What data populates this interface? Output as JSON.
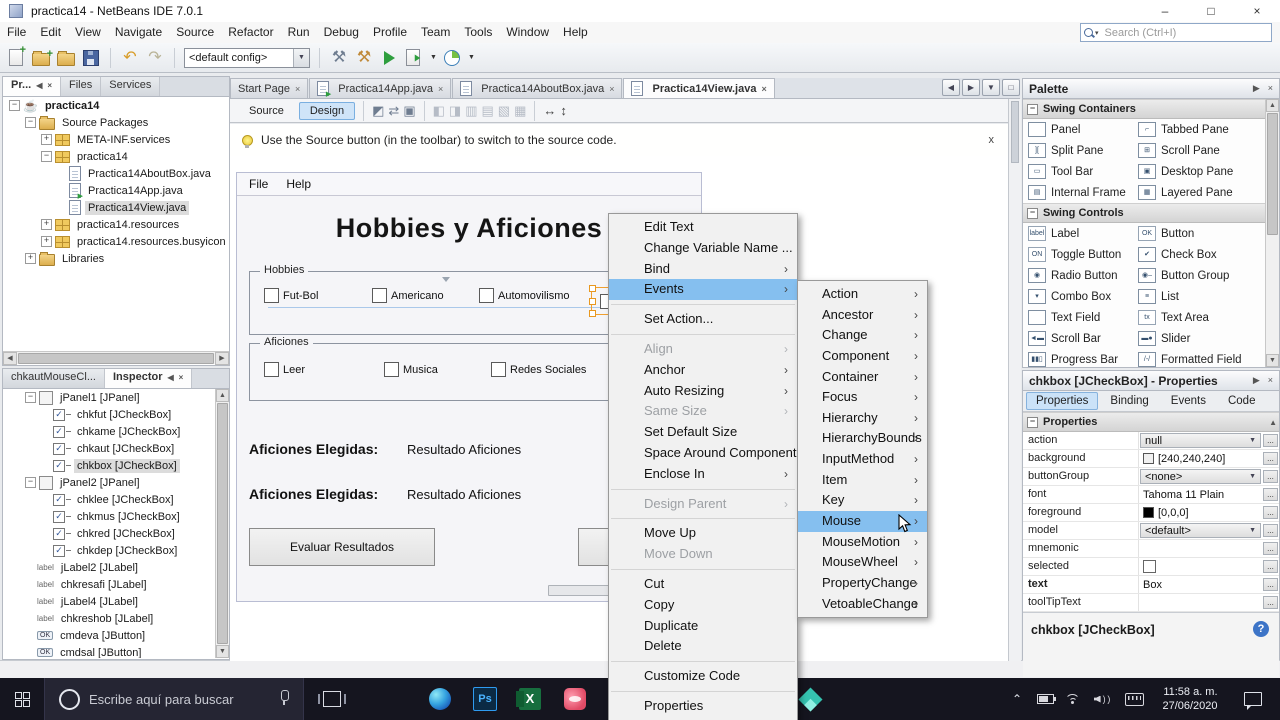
{
  "window": {
    "title": "practica14 - NetBeans IDE 7.0.1",
    "controls": {
      "minimize": "–",
      "maximize": "□",
      "close": "×"
    }
  },
  "menubar": {
    "items": [
      "File",
      "Edit",
      "View",
      "Navigate",
      "Source",
      "Refactor",
      "Run",
      "Debug",
      "Profile",
      "Team",
      "Tools",
      "Window",
      "Help"
    ],
    "search_placeholder": "Search (Ctrl+I)"
  },
  "toolbar": {
    "config_value": "<default config>"
  },
  "projects": {
    "tabs": [
      "Pr...",
      "Files",
      "Services"
    ],
    "tree": [
      {
        "label": "practica14",
        "icon": "project-icon",
        "indent": 0,
        "exp": "-",
        "bold": true
      },
      {
        "label": "Source Packages",
        "icon": "folder-icon",
        "indent": 1,
        "exp": "-"
      },
      {
        "label": "META-INF.services",
        "icon": "package-icon",
        "indent": 2,
        "exp": "+"
      },
      {
        "label": "practica14",
        "icon": "package-icon",
        "indent": 2,
        "exp": "-"
      },
      {
        "label": "Practica14AboutBox.java",
        "icon": "java-file-icon",
        "indent": 3
      },
      {
        "label": "Practica14App.java",
        "icon": "java-main-icon",
        "indent": 3
      },
      {
        "label": "Practica14View.java",
        "icon": "java-file-icon",
        "indent": 3,
        "selected": true
      },
      {
        "label": "practica14.resources",
        "icon": "package-icon",
        "indent": 2,
        "exp": "+"
      },
      {
        "label": "practica14.resources.busyicon",
        "icon": "package-icon",
        "indent": 2,
        "exp": "+"
      },
      {
        "label": "Libraries",
        "icon": "libraries-icon",
        "indent": 1,
        "exp": "+"
      }
    ]
  },
  "inspector": {
    "tabs": [
      "chkautMouseCl...",
      "Inspector"
    ],
    "nodes": [
      {
        "label": "jPanel1 [JPanel]",
        "icon": "panel-icon",
        "indent": 1,
        "exp": "-"
      },
      {
        "label": "chkfut [JCheckBox]",
        "icon": "checkbox-icon",
        "indent": 2
      },
      {
        "label": "chkame [JCheckBox]",
        "icon": "checkbox-icon",
        "indent": 2
      },
      {
        "label": "chkaut [JCheckBox]",
        "icon": "checkbox-icon",
        "indent": 2
      },
      {
        "label": "chkbox [JCheckBox]",
        "icon": "checkbox-icon",
        "indent": 2,
        "selected": true
      },
      {
        "label": "jPanel2 [JPanel]",
        "icon": "panel-icon",
        "indent": 1,
        "exp": "-"
      },
      {
        "label": "chklee [JCheckBox]",
        "icon": "checkbox-icon",
        "indent": 2
      },
      {
        "label": "chkmus [JCheckBox]",
        "icon": "checkbox-icon",
        "indent": 2
      },
      {
        "label": "chkred [JCheckBox]",
        "icon": "checkbox-icon",
        "indent": 2
      },
      {
        "label": "chkdep [JCheckBox]",
        "icon": "checkbox-icon",
        "indent": 2
      },
      {
        "label": "jLabel2 [JLabel]",
        "icon": "label-icon",
        "indent": 1
      },
      {
        "label": "chkresafi [JLabel]",
        "icon": "label-icon",
        "indent": 1
      },
      {
        "label": "jLabel4 [JLabel]",
        "icon": "label-icon",
        "indent": 1
      },
      {
        "label": "chkreshob [JLabel]",
        "icon": "label-icon",
        "indent": 1
      },
      {
        "label": "cmdeva [JButton]",
        "icon": "button-icon",
        "indent": 1
      },
      {
        "label": "cmdsal [JButton]",
        "icon": "button-icon",
        "indent": 1
      }
    ]
  },
  "editor": {
    "tabs": [
      {
        "label": "Start Page",
        "icon": "none"
      },
      {
        "label": "Practica14App.java",
        "icon": "java-main-icon"
      },
      {
        "label": "Practica14AboutBox.java",
        "icon": "java-file-icon"
      },
      {
        "label": "Practica14View.java",
        "icon": "java-file-icon",
        "active": true
      }
    ],
    "source_label": "Source",
    "design_label": "Design",
    "hint": "Use the Source button (in the toolbar) to switch to the source code.",
    "hint_close": "x"
  },
  "form": {
    "menu": [
      "File",
      "Help"
    ],
    "title": "Hobbies y Aficiones",
    "groups": [
      {
        "label": "Hobbies",
        "items": [
          "Fut-Bol",
          "Americano",
          "Automovilismo"
        ]
      },
      {
        "label": "Aficiones",
        "items": [
          "Leer",
          "Musica",
          "Redes Sociales"
        ]
      }
    ],
    "results": [
      {
        "label": "Aficiones Elegidas:",
        "value": "Resultado Aficiones"
      },
      {
        "label": "Aficiones Elegidas:",
        "value": "Resultado Aficiones"
      }
    ],
    "button_label": "Evaluar Resultados"
  },
  "context_menu": {
    "items": [
      {
        "label": "Edit Text"
      },
      {
        "label": "Change Variable Name ..."
      },
      {
        "label": "Bind",
        "submenu": true
      },
      {
        "label": "Events",
        "submenu": true,
        "highlighted": true
      },
      {
        "sep": true
      },
      {
        "label": "Set Action..."
      },
      {
        "sep": true
      },
      {
        "label": "Align",
        "submenu": true,
        "disabled": true
      },
      {
        "label": "Anchor",
        "submenu": true
      },
      {
        "label": "Auto Resizing",
        "submenu": true
      },
      {
        "label": "Same Size",
        "submenu": true,
        "disabled": true
      },
      {
        "label": "Set Default Size"
      },
      {
        "label": "Space Around Component..."
      },
      {
        "label": "Enclose In",
        "submenu": true
      },
      {
        "sep": true
      },
      {
        "label": "Design Parent",
        "submenu": true,
        "disabled": true
      },
      {
        "sep": true
      },
      {
        "label": "Move Up"
      },
      {
        "label": "Move Down",
        "disabled": true
      },
      {
        "sep": true
      },
      {
        "label": "Cut"
      },
      {
        "label": "Copy"
      },
      {
        "label": "Duplicate"
      },
      {
        "label": "Delete"
      },
      {
        "sep": true
      },
      {
        "label": "Customize Code"
      },
      {
        "sep": true
      },
      {
        "label": "Properties"
      }
    ]
  },
  "events_submenu": {
    "items": [
      "Action",
      "Ancestor",
      "Change",
      "Component",
      "Container",
      "Focus",
      "Hierarchy",
      "HierarchyBounds",
      "InputMethod",
      "Item",
      "Key",
      "Mouse",
      "MouseMotion",
      "MouseWheel",
      "PropertyChange",
      "VetoableChange"
    ],
    "highlighted": "Mouse"
  },
  "palette": {
    "title": "Palette",
    "sections": [
      {
        "title": "Swing Containers",
        "items": [
          {
            "label": "Panel",
            "icon": "panel-icon",
            "glyph": ""
          },
          {
            "label": "Tabbed Pane",
            "icon": "tabbed-pane-icon",
            "glyph": "⌐"
          },
          {
            "label": "Split Pane",
            "icon": "split-pane-icon",
            "glyph": "]["
          },
          {
            "label": "Scroll Pane",
            "icon": "scroll-pane-icon",
            "glyph": "⊞"
          },
          {
            "label": "Tool Bar",
            "icon": "tool-bar-icon",
            "glyph": "▭"
          },
          {
            "label": "Desktop Pane",
            "icon": "desktop-pane-icon",
            "glyph": "▣"
          },
          {
            "label": "Internal Frame",
            "icon": "internal-frame-icon",
            "glyph": "▤"
          },
          {
            "label": "Layered Pane",
            "icon": "layered-pane-icon",
            "glyph": "▦"
          }
        ]
      },
      {
        "title": "Swing Controls",
        "items": [
          {
            "label": "Label",
            "icon": "label-icon",
            "glyph": "label"
          },
          {
            "label": "Button",
            "icon": "button-icon",
            "glyph": "OK"
          },
          {
            "label": "Toggle Button",
            "icon": "toggle-button-icon",
            "glyph": "ON"
          },
          {
            "label": "Check Box",
            "icon": "check-box-icon",
            "glyph": "✔"
          },
          {
            "label": "Radio Button",
            "icon": "radio-button-icon",
            "glyph": "◉"
          },
          {
            "label": "Button Group",
            "icon": "button-group-icon",
            "glyph": "◉–"
          },
          {
            "label": "Combo Box",
            "icon": "combo-box-icon",
            "glyph": "▾"
          },
          {
            "label": "List",
            "icon": "list-icon",
            "glyph": "≡"
          },
          {
            "label": "Text Field",
            "icon": "text-field-icon",
            "glyph": ""
          },
          {
            "label": "Text Area",
            "icon": "text-area-icon",
            "glyph": "tx"
          },
          {
            "label": "Scroll Bar",
            "icon": "scroll-bar-icon",
            "glyph": "◄▬"
          },
          {
            "label": "Slider",
            "icon": "slider-icon",
            "glyph": "▬●"
          },
          {
            "label": "Progress Bar",
            "icon": "progress-bar-icon",
            "glyph": "▮▮▯"
          },
          {
            "label": "Formatted Field",
            "icon": "formatted-field-icon",
            "glyph": "/-/"
          }
        ]
      }
    ]
  },
  "properties": {
    "header": "chkbox [JCheckBox] - Properties",
    "tabs": [
      "Properties",
      "Binding",
      "Events",
      "Code"
    ],
    "active_tab": "Properties",
    "section": "Properties",
    "rows": [
      {
        "name": "action",
        "type": "dropdown",
        "value": "null"
      },
      {
        "name": "background",
        "type": "color",
        "value": "[240,240,240]",
        "swatch": "#f0f0f0"
      },
      {
        "name": "buttonGroup",
        "type": "dropdown",
        "value": "<none>"
      },
      {
        "name": "font",
        "type": "text",
        "value": "Tahoma 11 Plain"
      },
      {
        "name": "foreground",
        "type": "color",
        "value": "[0,0,0]",
        "swatch": "#000000"
      },
      {
        "name": "model",
        "type": "dropdown",
        "value": "<default>"
      },
      {
        "name": "mnemonic",
        "type": "text",
        "value": ""
      },
      {
        "name": "selected",
        "type": "check",
        "value": ""
      },
      {
        "name": "text",
        "type": "text",
        "value": "Box",
        "bold": true
      },
      {
        "name": "toolTipText",
        "type": "text",
        "value": ""
      }
    ],
    "footer": "chkbox [JCheckBox]",
    "help_glyph": "?"
  },
  "taskbar": {
    "search_placeholder": "Escribe aquí para buscar",
    "time": "11:58 a. m.",
    "date": "27/06/2020"
  },
  "colors": {
    "menu_highlight": "#85bfef",
    "selection_orange": "#f0a030",
    "run_green": "#2e9e3e",
    "taskbar_bg": "#15151f"
  }
}
